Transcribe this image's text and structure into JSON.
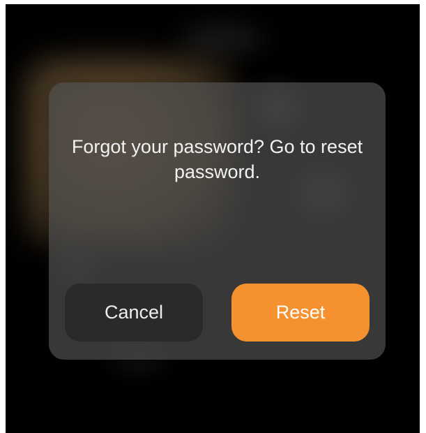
{
  "dialog": {
    "message": "Forgot your password? Go to reset password.",
    "cancel_label": "Cancel",
    "reset_label": "Reset"
  },
  "colors": {
    "accent": "#f5912e",
    "dialog_background": "#4e4e4e",
    "cancel_button": "#2a2a2a",
    "screen_background": "#000000",
    "text": "#f2f2f2"
  }
}
